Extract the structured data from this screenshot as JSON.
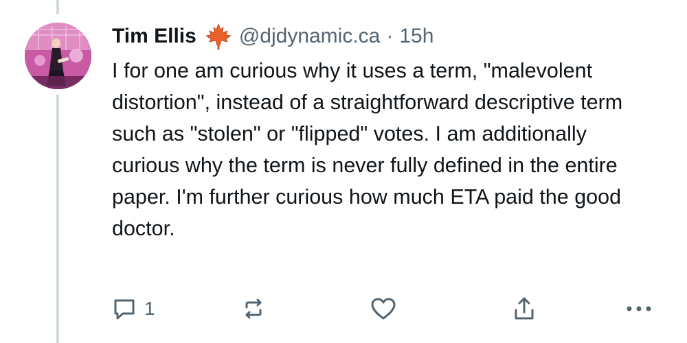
{
  "post": {
    "author_name": "Tim Ellis",
    "flair_icon": "maple-leaf-icon",
    "handle": "@djdynamic.ca",
    "separator": "·",
    "time": "15h",
    "text": "I for one am curious why it uses a term, \"malevolent distortion\", instead of a straightforward descriptive term such as \"stolen\" or \"flipped\" votes. I am additionally curious why the term is never fully defined in the entire paper. I'm further curious how much ETA paid the good doctor.",
    "actions": {
      "reply_count": "1",
      "reply_icon": "reply-icon",
      "repost_icon": "repost-icon",
      "like_icon": "heart-icon",
      "share_icon": "share-icon",
      "more_icon": "more-icon"
    }
  },
  "colors": {
    "text_primary": "#0f1419",
    "text_secondary": "#536471",
    "thread_line": "#cfd9de",
    "maple_leaf": "#e8622a"
  }
}
